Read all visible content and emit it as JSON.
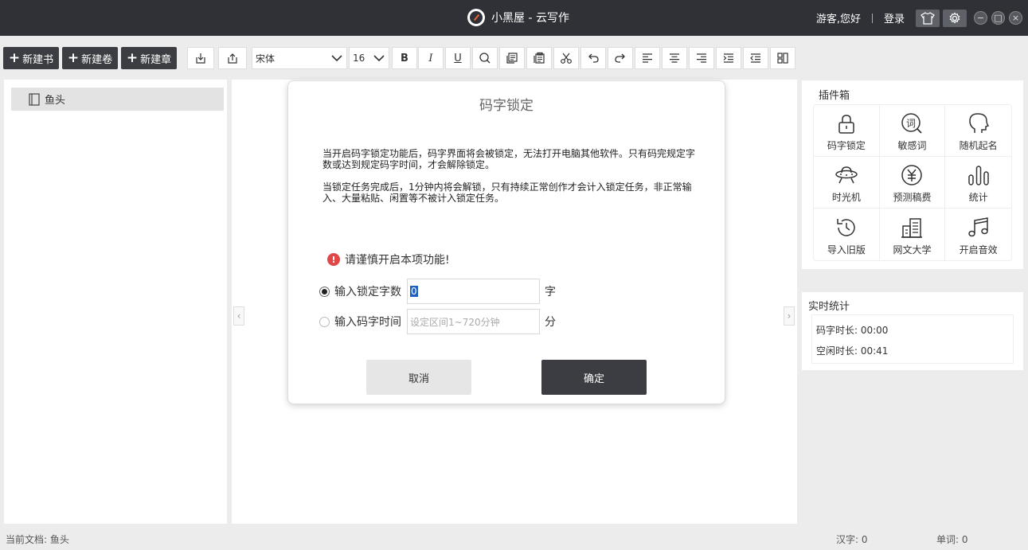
{
  "window": {
    "title": "小黑屋 - 云写作",
    "greeting": "游客,您好",
    "login": "登录",
    "minimize": "−",
    "maximize": "□",
    "close": "×"
  },
  "toolbar": {
    "new_book": "新建书",
    "new_volume": "新建卷",
    "new_chapter": "新建章",
    "font_family": "宋体",
    "font_size": "16",
    "bold": "B",
    "italic": "I",
    "underline": "U"
  },
  "sidebar": {
    "doc_title": "鱼头"
  },
  "modal": {
    "title": "码字锁定",
    "paragraph1": "当开启码字锁定功能后，码字界面将会被锁定，无法打开电脑其他软件。只有码完规定字数或达到规定码字时间，才会解除锁定。",
    "paragraph2": "当锁定任务完成后，1分钟内将会解锁，只有持续正常创作才会计入锁定任务，非正常输入、大量粘贴、闲置等不被计入锁定任务。",
    "warning": "请谨慎开启本项功能!",
    "warning_icon": "!",
    "option_words_label": "输入锁定字数",
    "option_words_value": "0",
    "option_words_unit": "字",
    "option_time_label": "输入码字时间",
    "option_time_placeholder": "设定区间1~720分钟",
    "option_time_unit": "分",
    "cancel": "取消",
    "confirm": "确定"
  },
  "plugins": {
    "title": "插件箱",
    "items": [
      {
        "label": "码字锁定",
        "icon": "lock-icon"
      },
      {
        "label": "敏感词",
        "icon": "sensitive-word-icon"
      },
      {
        "label": "随机起名",
        "icon": "head-icon"
      },
      {
        "label": "时光机",
        "icon": "ufo-icon"
      },
      {
        "label": "预测稿费",
        "icon": "yen-icon"
      },
      {
        "label": "统计",
        "icon": "bar-chart-icon"
      },
      {
        "label": "导入旧版",
        "icon": "history-icon"
      },
      {
        "label": "网文大学",
        "icon": "building-icon"
      },
      {
        "label": "开启音效",
        "icon": "music-icon"
      }
    ]
  },
  "stats": {
    "title": "实时统计",
    "typing_time": "码字时长: 00:00",
    "idle_time": "空闲时长: 00:41"
  },
  "status": {
    "current_doc": "当前文档: 鱼头",
    "hanzi": "汉字: 0",
    "words": "单词: 0"
  }
}
